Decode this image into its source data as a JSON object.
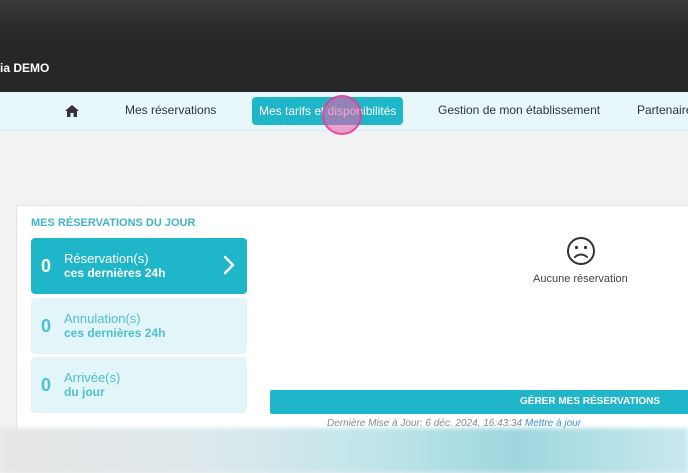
{
  "header": {
    "app_title": "ia DEMO"
  },
  "nav": {
    "items": [
      {
        "label": "Mes réservations"
      },
      {
        "label": "Mes tarifs et disponibilités"
      },
      {
        "label": "Gestion de mon établissement"
      },
      {
        "label": "Partenaire"
      }
    ],
    "home_icon": "home-icon",
    "active_index": 1
  },
  "dashboard": {
    "title": "MES RÉSERVATIONS DU JOUR",
    "stats": [
      {
        "count": "0",
        "label": "Réservation(s)",
        "sublabel": "ces dernières 24h"
      },
      {
        "count": "0",
        "label": "Annulation(s)",
        "sublabel": "ces dernières 24h"
      },
      {
        "count": "0",
        "label": "Arrivée(s)",
        "sublabel": "du jour"
      }
    ],
    "empty_text": "Aucune réservation",
    "empty_icon": "sad-face-icon",
    "manage_button": "GÉRER MES RÉSERVATIONS",
    "last_update_prefix": "Dernière Mise à Jour: 6 déc. 2024, 16:43:34",
    "refresh_link": "Mettre à jour"
  },
  "colors": {
    "accent": "#1fb6c9",
    "header_bg": "#272727",
    "nav_bg": "#e7f7fb"
  }
}
